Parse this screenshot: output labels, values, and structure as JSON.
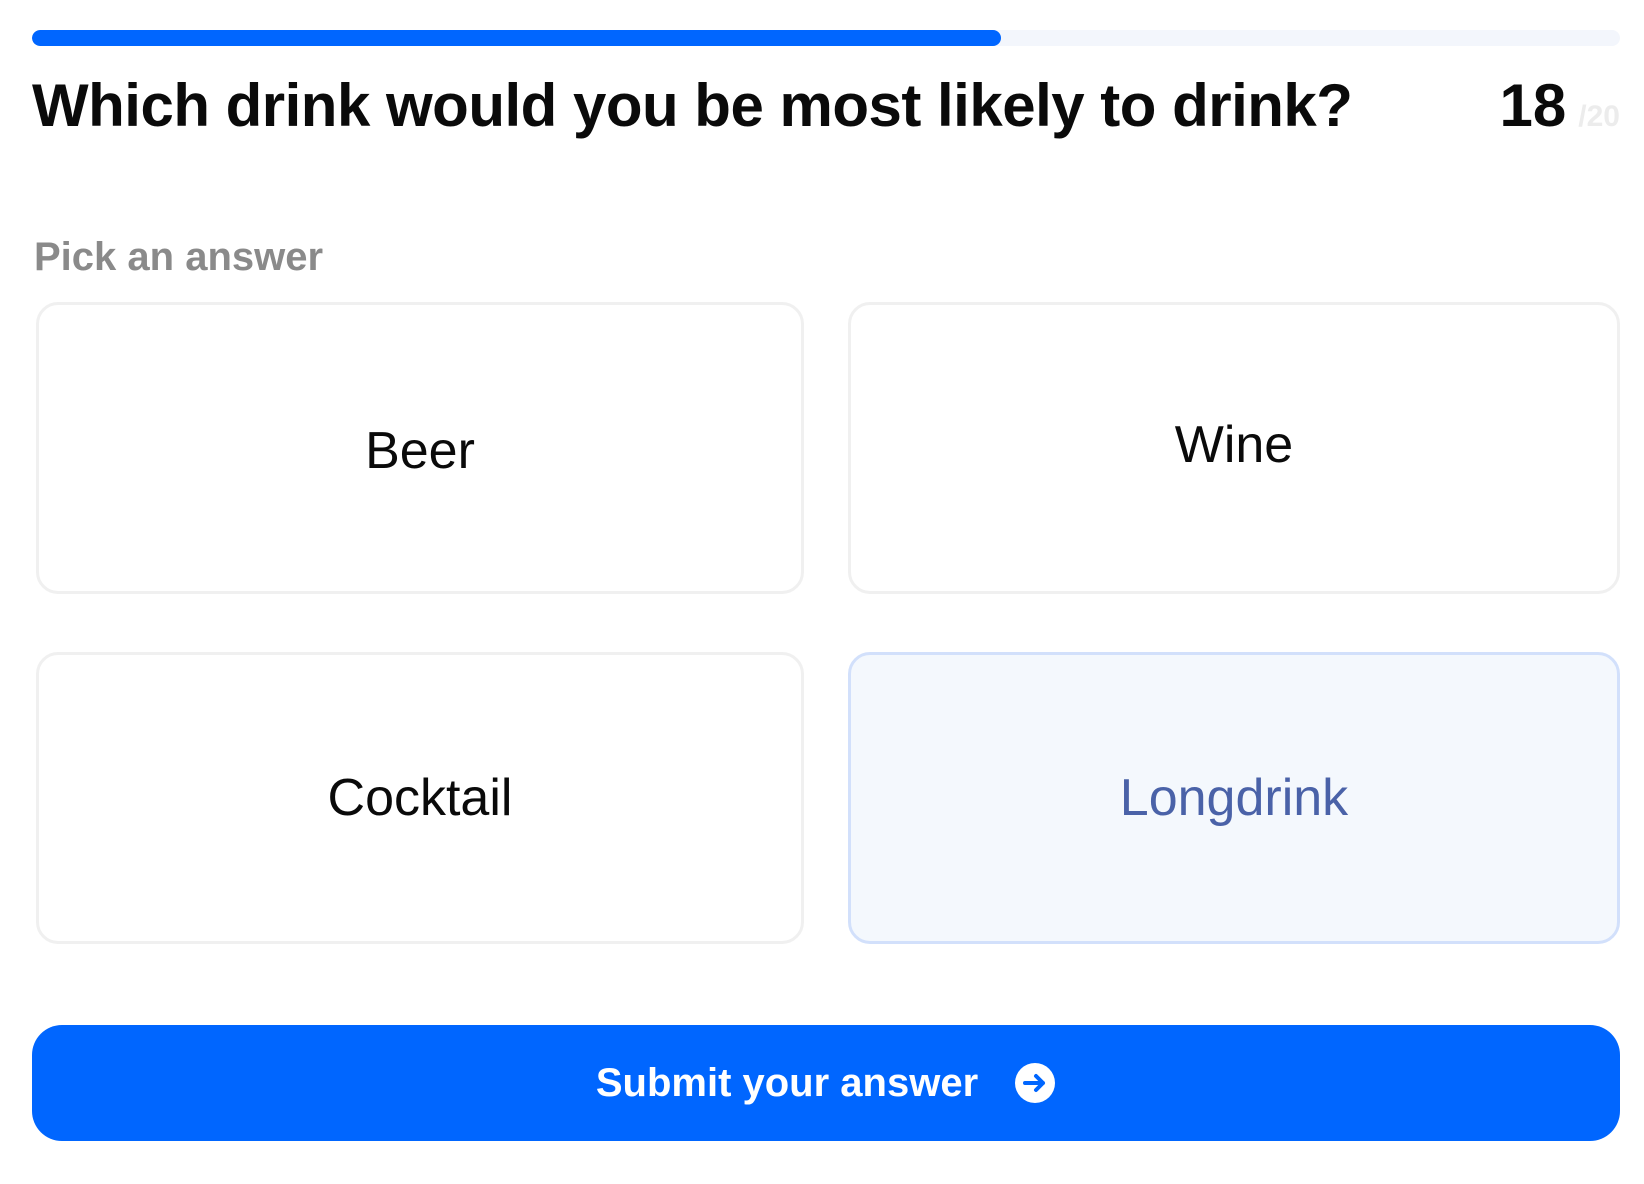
{
  "progress": {
    "fraction": 0.61,
    "current": "18",
    "total": "/20"
  },
  "question": "Which drink would you be most likely to drink?",
  "prompt": "Pick an answer",
  "options": [
    {
      "label": "Beer",
      "selected": false
    },
    {
      "label": "Wine",
      "selected": false
    },
    {
      "label": "Cocktail",
      "selected": false
    },
    {
      "label": "Longdrink",
      "selected": true
    }
  ],
  "submit": {
    "label": "Submit your answer",
    "icon": "arrow-right-circle-icon"
  },
  "colors": {
    "accent": "#0066ff",
    "selected_text": "#4a62a8",
    "selected_bg": "#f4f8fd"
  }
}
